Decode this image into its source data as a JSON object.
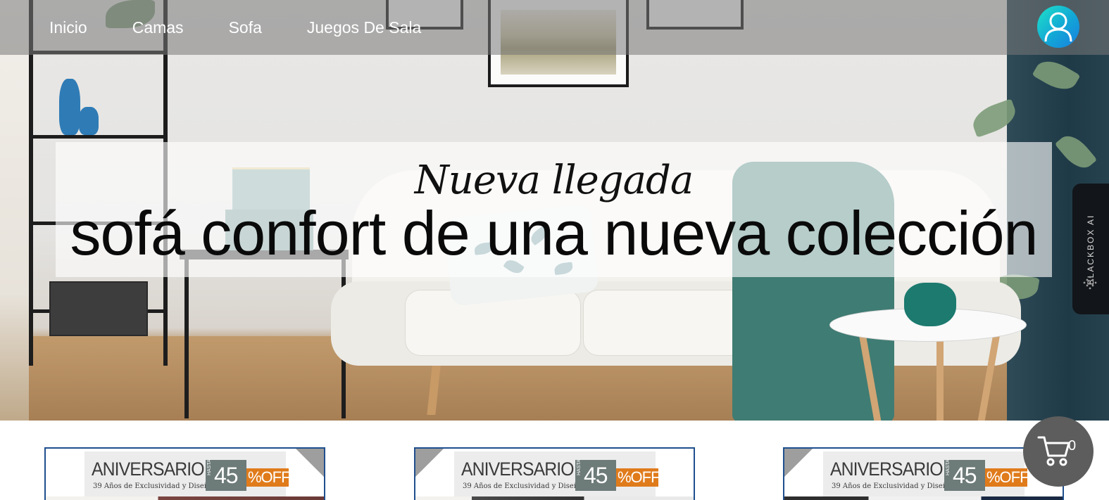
{
  "nav": {
    "items": [
      {
        "label": "Inicio"
      },
      {
        "label": "Camas"
      },
      {
        "label": "Sofa"
      },
      {
        "label": "Juegos De Sala"
      }
    ]
  },
  "hero": {
    "script_heading": "Nueva llegada",
    "main_heading": "sofá confort de una nueva colección"
  },
  "blackbox": {
    "label": "BLACKBOX AI"
  },
  "promo": {
    "cards": [
      {
        "title": "ANIVERSARIO",
        "subtitle": "39 Años de Exclusividad y Diseño",
        "hasta": "HASTA",
        "percent": "45",
        "off": "%OFF"
      },
      {
        "title": "ANIVERSARIO",
        "subtitle": "39 Años de Exclusividad y Diseño",
        "hasta": "HASTA",
        "percent": "45",
        "off": "%OFF"
      },
      {
        "title": "ANIVERSARIO",
        "subtitle": "39 Años de Exclusividad y Diseño",
        "hasta": "HASTA",
        "percent": "45",
        "off": "%OFF"
      }
    ]
  },
  "cart": {
    "count": "0"
  },
  "colors": {
    "nav_overlay": "#787878",
    "card_border": "#1f4f8e",
    "off_badge": "#e07b1b",
    "cart_bg": "#5d5d5d",
    "user_gradient_start": "#1fe3c8",
    "user_gradient_end": "#1a7fe0"
  },
  "icons": {
    "user": "user-icon",
    "cart": "cart-icon",
    "blackbox": "blackbox-logo-icon"
  }
}
